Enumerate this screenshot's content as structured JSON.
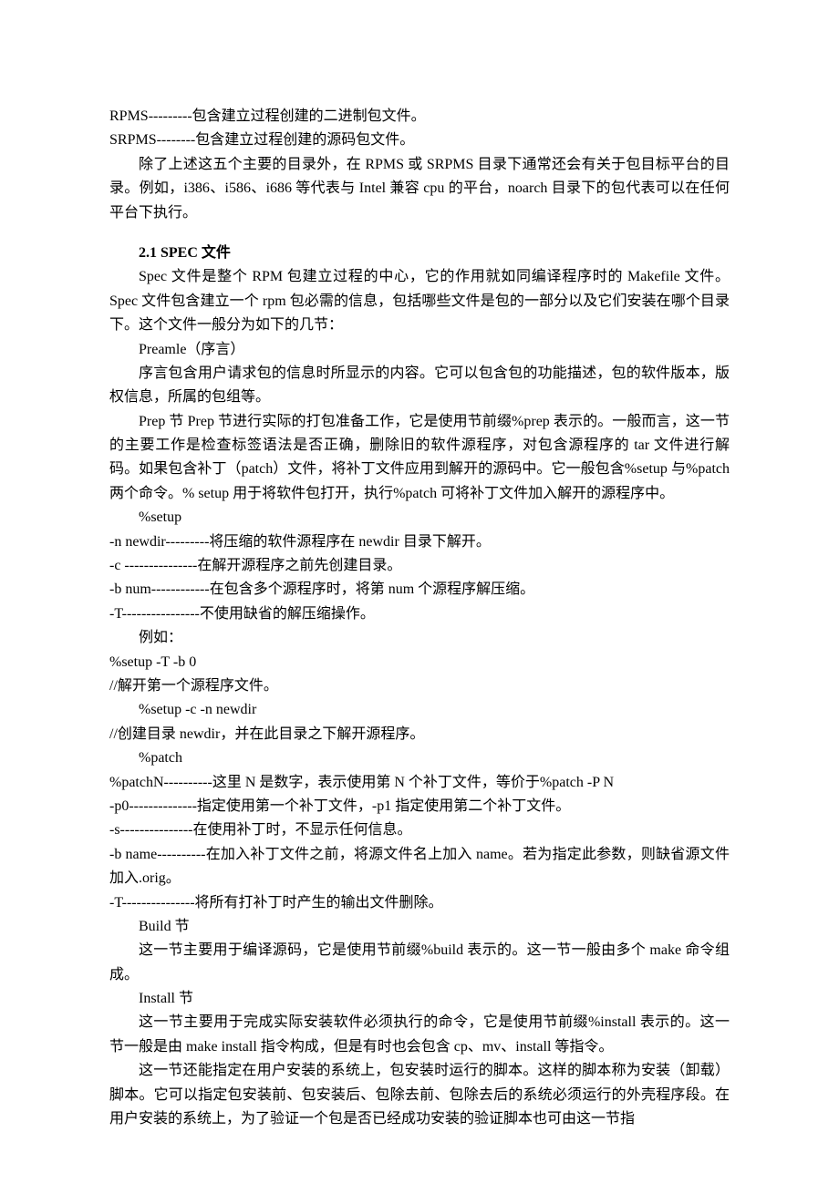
{
  "lines": {
    "l1": "RPMS---------包含建立过程创建的二进制包文件。",
    "l2": "SRPMS--------包含建立过程创建的源码包文件。",
    "l3": "除了上述这五个主要的目录外，在 RPMS 或 SRPMS 目录下通常还会有关于包目标平台的目录。例如，i386、i586、i686 等代表与 Intel 兼容 cpu 的平台，noarch 目录下的包代表可以在任何平台下执行。",
    "sec1": "2.1 SPEC 文件",
    "l4": "Spec 文件是整个 RPM 包建立过程的中心，它的作用就如同编译程序时的 Makefile 文件。Spec 文件包含建立一个 rpm 包必需的信息，包括哪些文件是包的一部分以及它们安装在哪个目录下。这个文件一般分为如下的几节：",
    "l5": "Preamle（序言）",
    "l6": "序言包含用户请求包的信息时所显示的内容。它可以包含包的功能描述，包的软件版本，版权信息，所属的包组等。",
    "l7": "Prep 节 Prep 节进行实际的打包准备工作，它是使用节前缀%prep 表示的。一般而言，这一节的主要工作是检查标签语法是否正确，删除旧的软件源程序，对包含源程序的 tar 文件进行解码。如果包含补丁（patch）文件，将补丁文件应用到解开的源码中。它一般包含%setup 与%patch 两个命令。% setup 用于将软件包打开，执行%patch 可将补丁文件加入解开的源程序中。",
    "l8": "%setup",
    "l9": "-n newdir---------将压缩的软件源程序在 newdir 目录下解开。",
    "l10": "-c ---------------在解开源程序之前先创建目录。",
    "l11": "-b num------------在包含多个源程序时，将第 num 个源程序解压缩。",
    "l12": "-T----------------不使用缺省的解压缩操作。",
    "l13": "例如：",
    "l14": "%setup -T -b 0",
    "l15": "//解开第一个源程序文件。",
    "l16": "%setup -c -n newdir",
    "l17": "//创建目录 newdir，并在此目录之下解开源程序。",
    "l18": "%patch",
    "l19": "%patchN----------这里 N 是数字，表示使用第 N 个补丁文件，等价于%patch -P N",
    "l20": "-p0--------------指定使用第一个补丁文件，-p1 指定使用第二个补丁文件。",
    "l21": "-s---------------在使用补丁时，不显示任何信息。",
    "l22": "-b name----------在加入补丁文件之前，将源文件名上加入 name。若为指定此参数，则缺省源文件加入.orig。",
    "l23": "-T---------------将所有打补丁时产生的输出文件删除。",
    "l24": "Build 节",
    "l25": "这一节主要用于编译源码，它是使用节前缀%build 表示的。这一节一般由多个 make 命令组成。",
    "l26": "Install 节",
    "l27": "这一节主要用于完成实际安装软件必须执行的命令，它是使用节前缀%install 表示的。这一节一般是由 make install 指令构成，但是有时也会包含 cp、mv、install 等指令。",
    "l28": "这一节还能指定在用户安装的系统上，包安装时运行的脚本。这样的脚本称为安装（卸载）脚本。它可以指定包安装前、包安装后、包除去前、包除去后的系统必须运行的外壳程序段。在用户安装的系统上，为了验证一个包是否已经成功安装的验证脚本也可由这一节指"
  }
}
